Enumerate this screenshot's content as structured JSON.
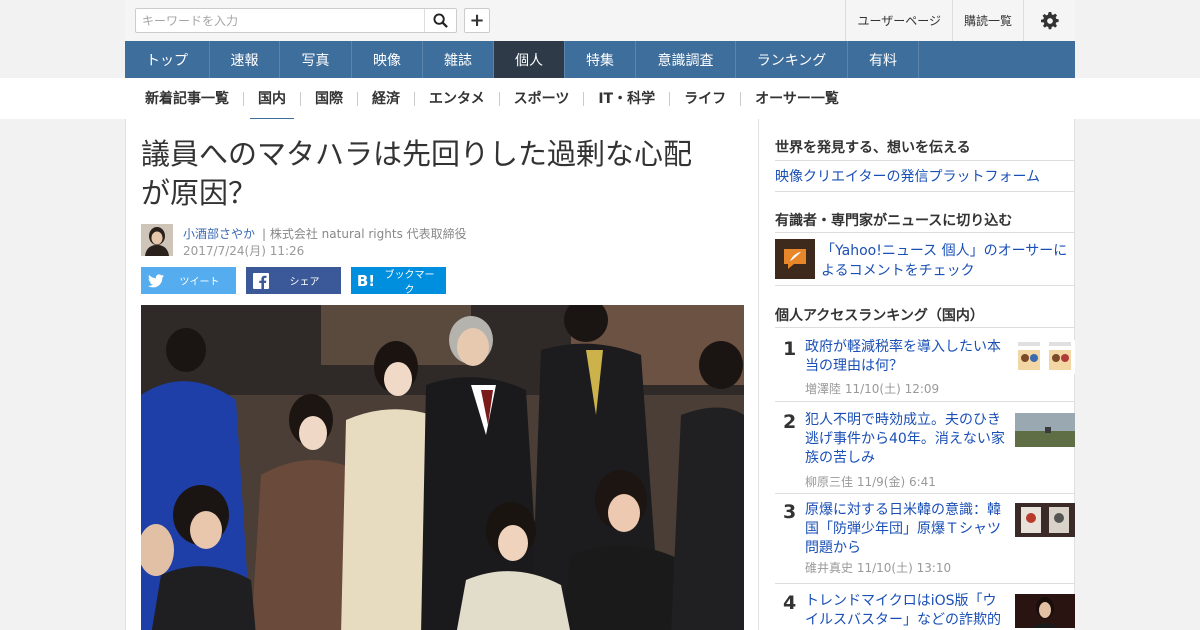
{
  "search": {
    "placeholder": "キーワードを入力"
  },
  "header": {
    "links": [
      "ユーザーページ",
      "購読一覧"
    ]
  },
  "main_nav": [
    "トップ",
    "速報",
    "写真",
    "映像",
    "雑誌",
    "個人",
    "特集",
    "意識調査",
    "ランキング",
    "有料"
  ],
  "main_nav_active": "個人",
  "sub_nav": [
    "新着記事一覧",
    "国内",
    "国際",
    "経済",
    "エンタメ",
    "スポーツ",
    "IT・科学",
    "ライフ",
    "オーサー一覧"
  ],
  "sub_nav_active": "国内",
  "article": {
    "headline_line1": "議員へのマタハラは先回りした過剰な心配",
    "headline_line2": "が原因？",
    "author": "小酒部さやか",
    "author_title": "| 株式会社 natural rights 代表取締役",
    "date": "2017/7/24(月) 11:26"
  },
  "share": {
    "tweet": "ツイート",
    "facebook": "シェア",
    "bookmark": "ブックマーク"
  },
  "sidebar": {
    "heading1": "世界を発見する、想いを伝える",
    "link1": "映像クリエイターの発信プラットフォーム",
    "heading2": "有識者・専門家がニュースに切り込む",
    "promo_line1": "「Yahoo!ニュース 個人」のオーサーに",
    "promo_line2": "よるコメントをチェック",
    "heading3": "個人アクセスランキング（国内）",
    "ranking": [
      {
        "rank": "1",
        "title_lines": [
          "政府が軽減税率を導入したい本",
          "当の理由は何？"
        ],
        "meta": "増澤陸  11/10(土) 12:09"
      },
      {
        "rank": "2",
        "title_lines": [
          "犯人不明で時効成立。夫のひき",
          "逃げ事件から40年。消えない家",
          "族の苦しみ"
        ],
        "meta": "柳原三佳  11/9(金) 6:41"
      },
      {
        "rank": "3",
        "title_lines": [
          "原爆に対する日米韓の意識：韓",
          "国「防弾少年団」原爆Ｔシャツ",
          "問題から"
        ],
        "meta": "碓井真史  11/10(土) 13:10"
      },
      {
        "rank": "4",
        "title_lines": [
          "トレンドマイクロはiOS版「ウ",
          "イルスバスター」などの詐欺的"
        ],
        "meta": ""
      }
    ]
  },
  "colors": {
    "nav": "#3e6e9c",
    "nav_active": "#2e3a48",
    "link": "#1a4fb5",
    "twitter": "#55acee",
    "facebook": "#3b5998",
    "hatena": "#008fde"
  }
}
